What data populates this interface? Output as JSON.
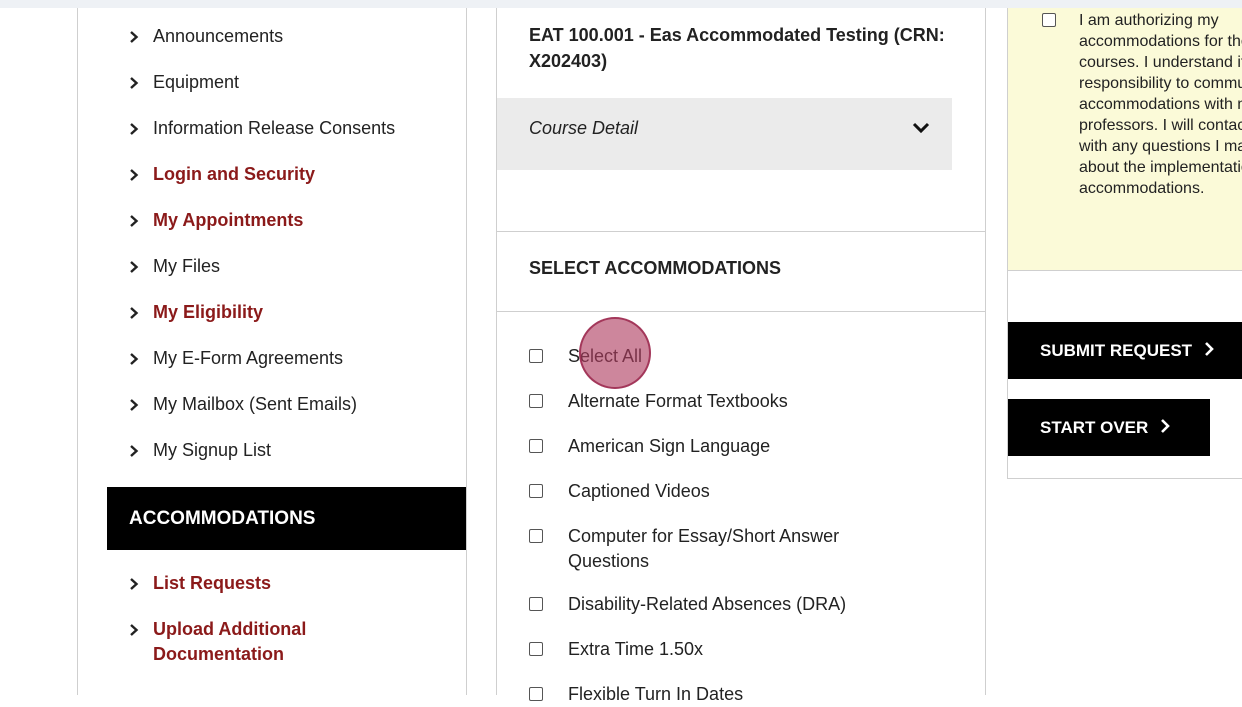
{
  "sidebar": {
    "items": [
      {
        "label": "Announcements",
        "emphasis": false
      },
      {
        "label": "Equipment",
        "emphasis": false
      },
      {
        "label": "Information Release Consents",
        "emphasis": false
      },
      {
        "label": "Login and Security",
        "emphasis": true
      },
      {
        "label": "My Appointments",
        "emphasis": true
      },
      {
        "label": "My Files",
        "emphasis": false
      },
      {
        "label": "My Eligibility",
        "emphasis": true
      },
      {
        "label": "My E-Form Agreements",
        "emphasis": false
      },
      {
        "label": "My Mailbox (Sent Emails)",
        "emphasis": false
      },
      {
        "label": "My Signup List",
        "emphasis": false
      }
    ],
    "accommodations_header": "ACCOMMODATIONS",
    "accommodations_items": [
      {
        "label": "List Requests"
      },
      {
        "label": "Upload Additional Documentation"
      }
    ]
  },
  "course": {
    "title": "EAT 100.001 - Eas Accommodated Testing (CRN: X202403)",
    "detail_label": "Course Detail"
  },
  "accommodations": {
    "heading": "SELECT ACCOMMODATIONS",
    "select_all": "Select All",
    "options": [
      "Alternate Format Textbooks",
      "American Sign Language",
      "Captioned Videos",
      "Computer for Essay/Short Answer Questions",
      "Disability-Related Absences (DRA)",
      "Extra Time 1.50x",
      "Flexible Turn In Dates"
    ]
  },
  "authorization": {
    "text": "I am authorizing my accommodations for the selected courses. I understand it is my responsibility to communicate my accommodations with my professors. I will contact the office with any questions I may have about the implementation of my accommodations."
  },
  "buttons": {
    "submit": "SUBMIT REQUEST",
    "start_over": "START OVER"
  },
  "colors": {
    "accent_text": "#8b1a1a",
    "header_bg": "#000000",
    "auth_bg": "#fbfad8",
    "click_marker": "#b03c5f"
  }
}
